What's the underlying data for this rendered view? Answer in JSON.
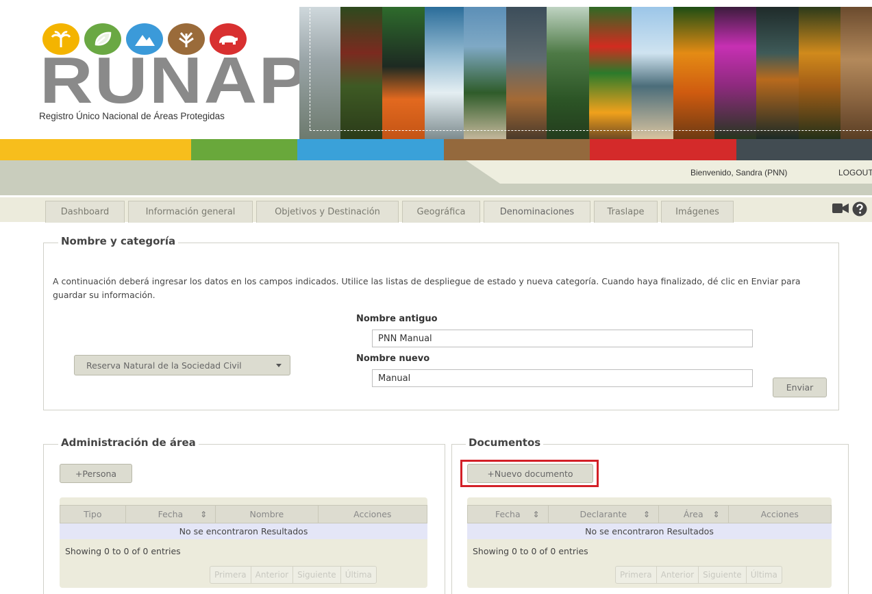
{
  "app": {
    "logo_text": "RUNAP",
    "logo_subtitle": "Registro Único Nacional de Áreas Protegidas"
  },
  "colors": {
    "bar": [
      "#f7be1c",
      "#69a83b",
      "#3aa1d9",
      "#94693d",
      "#d42a2a",
      "#424c52"
    ],
    "logo_circles": [
      "#f4b400",
      "#6aa843",
      "#3b9ad9",
      "#9a6b3a",
      "#d83030"
    ],
    "highlight": "#d32027"
  },
  "header": {
    "welcome": "Bienvenido, Sandra (PNN)",
    "logout": "LOGOUT"
  },
  "tabs": [
    {
      "label": "Dashboard"
    },
    {
      "label": "Información general"
    },
    {
      "label": "Objetivos y Destinación"
    },
    {
      "label": "Geográfica"
    },
    {
      "label": "Denominaciones"
    },
    {
      "label": "Traslape"
    },
    {
      "label": "Imágenes"
    }
  ],
  "icons": [
    "video-camera-icon",
    "help-icon",
    "sort-icon",
    "caret-down-icon"
  ],
  "nombre": {
    "legend": "Nombre y categoría",
    "intro": "A continuación deberá ingresar los datos en los campos indicados. Utilice las listas de despliegue de estado y nueva categoría. Cuando haya finalizado, dé clic en Enviar para guardar su información.",
    "category_value": "Reserva Natural de la Sociedad Civil",
    "old_name_label": "Nombre antiguo",
    "old_name_value": "PNN Manual",
    "new_name_label": "Nombre nuevo",
    "new_name_value": "Manual",
    "submit_label": "Enviar"
  },
  "administracion": {
    "legend": "Administración de área",
    "add_label": "+Persona",
    "columns": [
      "Tipo",
      "Fecha",
      "Nombre",
      "Acciones"
    ],
    "empty": "No se encontraron Resultados",
    "info": "Showing 0 to 0 of 0 entries",
    "pager": [
      "Primera",
      "Anterior",
      "Siguiente",
      "Última"
    ]
  },
  "documentos": {
    "legend": "Documentos",
    "add_label": "+Nuevo documento",
    "columns": [
      "Fecha",
      "Declarante",
      "Área",
      "Acciones"
    ],
    "empty": "No se encontraron Resultados",
    "info": "Showing 0 to 0 of 0 entries",
    "pager": [
      "Primera",
      "Anterior",
      "Siguiente",
      "Última"
    ]
  }
}
